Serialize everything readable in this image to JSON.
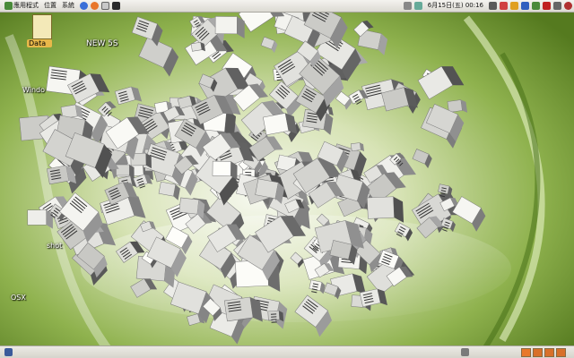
{
  "top_panel": {
    "applications_label": "應用程式",
    "places_label": "位置",
    "system_label": "系統",
    "clock": "6月15日(五) 00:16"
  },
  "desktop_icons": [
    {
      "label": "Data"
    },
    {
      "label": "Windo"
    },
    {
      "label": "shot"
    },
    {
      "label": "OSX"
    }
  ],
  "wallpaper_text": {
    "new_label": "NEW 5S"
  },
  "colors": {
    "accent": "#7aa63a",
    "panel": "#e4e2dc"
  }
}
